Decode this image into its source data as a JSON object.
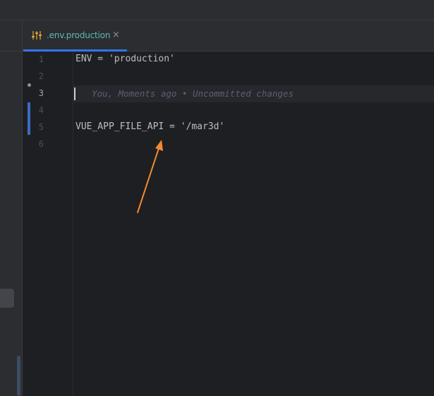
{
  "tab": {
    "label": ".env.production",
    "close_glyph": "×",
    "icon": "settings-sliders-icon",
    "accent_color": "#3574f0",
    "label_color": "#5fb8b8"
  },
  "editor": {
    "lines": [
      {
        "number": "1",
        "code": "ENV = 'production'"
      },
      {
        "number": "2",
        "code": ""
      },
      {
        "number": "3",
        "code": ""
      },
      {
        "number": "4",
        "code": ""
      },
      {
        "number": "5",
        "code": "VUE_APP_FILE_API = '/mar3d'"
      },
      {
        "number": "6",
        "code": ""
      }
    ],
    "current_line": "3",
    "blame_annotation": "You, Moments ago • Uncommitted changes"
  },
  "annotation": {
    "arrow_color": "#f28a30",
    "icon": "arrow-annotation-icon"
  }
}
